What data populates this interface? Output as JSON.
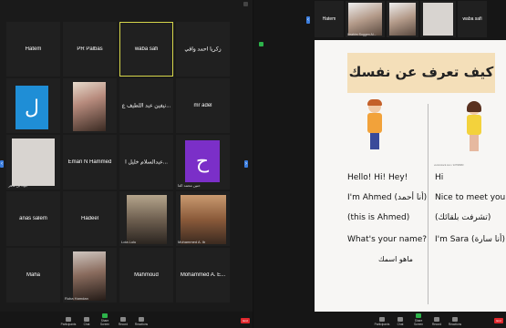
{
  "left": {
    "tiles": [
      {
        "kind": "name",
        "name": "Hatem"
      },
      {
        "kind": "name",
        "name": "PR Palbas"
      },
      {
        "kind": "name",
        "name": "waba safi",
        "highlight": true
      },
      {
        "kind": "name",
        "name": "زكريا احمد وافي"
      },
      {
        "kind": "blue",
        "letter": "ل"
      },
      {
        "kind": "photo",
        "style": "a",
        "sub": ""
      },
      {
        "kind": "name",
        "name": "نيفين عبد اللطيف ع..."
      },
      {
        "kind": "name",
        "name": "mr adel"
      },
      {
        "kind": "blank",
        "sub": "جواد بن ماهر"
      },
      {
        "kind": "name",
        "name": "Eman N Hammed"
      },
      {
        "kind": "name",
        "name": "عبدالسلام خليل ا..."
      },
      {
        "kind": "purple",
        "letter": "ح",
        "sub": "حنين محمد العا"
      },
      {
        "kind": "name",
        "name": "anas salem"
      },
      {
        "kind": "name",
        "name": "Hadeel"
      },
      {
        "kind": "photo",
        "style": "c",
        "sub": "Lola Lulu"
      },
      {
        "kind": "photo",
        "style": "d",
        "sub": "Mohammed A. Ib"
      },
      {
        "kind": "name",
        "name": "Maha"
      },
      {
        "kind": "photo",
        "style": "b",
        "sub": "Ruba Hamdan"
      },
      {
        "kind": "name",
        "name": "Mahmoud"
      },
      {
        "kind": "name",
        "name": "Mohammed A. E..."
      }
    ],
    "toolbar": [
      "Participants",
      "Chat",
      "Share Screen",
      "Record",
      "Reactions"
    ],
    "end": "End"
  },
  "right": {
    "thumbs": [
      {
        "kind": "name",
        "name": "Hatem"
      },
      {
        "kind": "photo",
        "cap": "Ibrahim Suggen Al..."
      },
      {
        "kind": "photo",
        "cap": ""
      },
      {
        "kind": "blank",
        "cap": ""
      },
      {
        "kind": "name",
        "name": "waba safi"
      }
    ],
    "slide": {
      "title": "كيف تعرف عن نفسك",
      "left_lines": [
        "Hello! Hi! Hey!",
        "I'm Ahmed (أنا أحمد)",
        "(this is Ahmed)",
        "What's your name?",
        "ماهو اسمك"
      ],
      "right_lines": [
        "Hi",
        "Nice to meet you.",
        "(تشرفت بلقائك)",
        "I'm Sara (أنا سارة)"
      ],
      "credit": "vectorstock.com / 22766683"
    },
    "toolbar": [
      "Participants",
      "Chat",
      "Share Screen",
      "Record",
      "Reactions"
    ],
    "end": "End"
  }
}
